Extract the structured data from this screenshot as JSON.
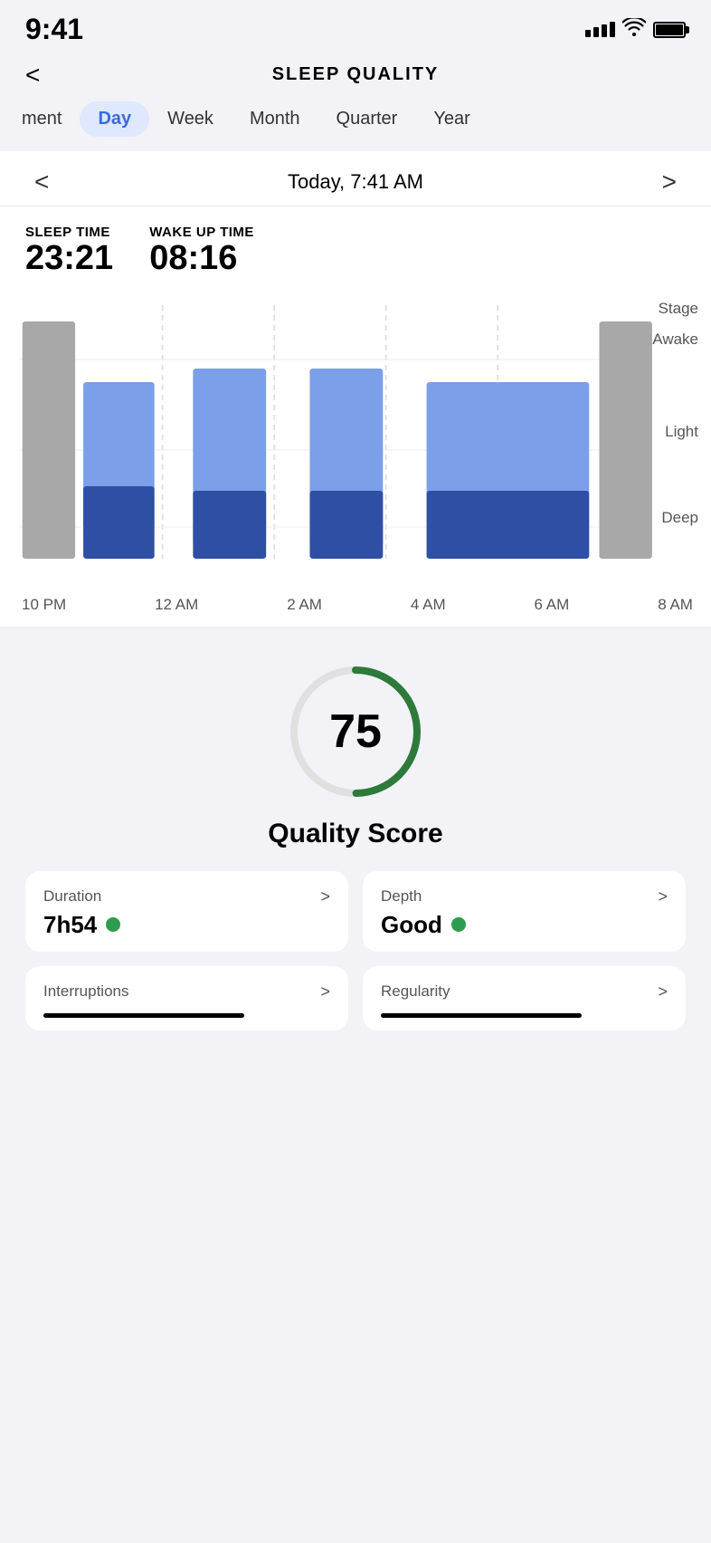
{
  "statusBar": {
    "time": "9:41",
    "signal": "signal",
    "wifi": "wifi",
    "battery": "battery"
  },
  "header": {
    "backLabel": "<",
    "title": "SLEEP QUALITY"
  },
  "tabs": [
    {
      "id": "movement",
      "label": "ment"
    },
    {
      "id": "day",
      "label": "Day"
    },
    {
      "id": "week",
      "label": "Week"
    },
    {
      "id": "month",
      "label": "Month"
    },
    {
      "id": "quarter",
      "label": "Quarter"
    },
    {
      "id": "year",
      "label": "Year"
    }
  ],
  "dateNav": {
    "prevArrow": "<",
    "nextArrow": ">",
    "label": "Today, 7:41 AM"
  },
  "sleepStats": {
    "sleepTimeLabel": "SLEEP TIME",
    "sleepTimeValue": "23:21",
    "wakeUpTimeLabel": "WAKE UP TIME",
    "wakeUpTimeValue": "08:16"
  },
  "chart": {
    "stageLabel": "Stage",
    "awakeLabel": "Awake",
    "lightLabel": "Light",
    "deepLabel": "Deep",
    "xLabels": [
      "10 PM",
      "12 AM",
      "2 AM",
      "4 AM",
      "6 AM",
      "8 AM"
    ]
  },
  "scoreSection": {
    "scoreValue": "75",
    "scoreTitle": "Quality Score",
    "scorePercent": 75
  },
  "metricCards": [
    {
      "label": "Duration",
      "arrow": ">",
      "value": "7h54",
      "hasDot": true
    },
    {
      "label": "Depth",
      "arrow": ">",
      "value": "Good",
      "hasDot": true
    }
  ],
  "bottomMetrics": [
    {
      "label": "Interruptions",
      "arrow": ">"
    },
    {
      "label": "Regularity",
      "arrow": ">"
    }
  ]
}
